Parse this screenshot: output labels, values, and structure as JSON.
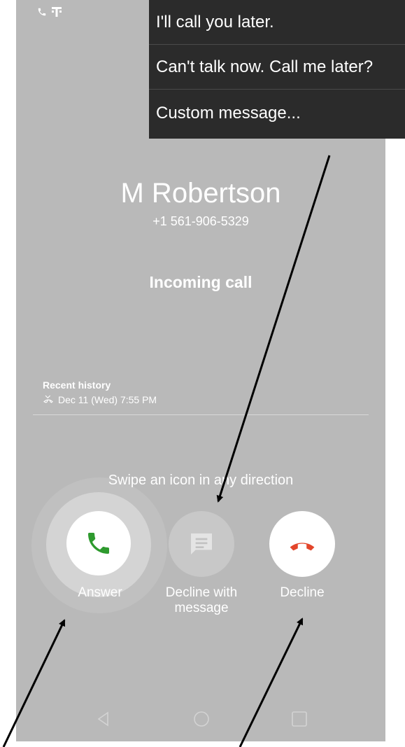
{
  "quick_replies": [
    "I'll call you later.",
    "Can't talk now. Call me later?",
    "Custom message..."
  ],
  "caller": {
    "name": "M Robertson",
    "number": "+1 561-906-5329",
    "status": "Incoming call"
  },
  "recent_history": {
    "title": "Recent history",
    "entry": "Dec 11 (Wed) 7:55 PM"
  },
  "swipe_hint": "Swipe an icon in any direction",
  "actions": {
    "answer_label": "Answer",
    "decline_with_message_label": "Decline with\nmessage",
    "decline_label": "Decline"
  },
  "colors": {
    "answer_green": "#2e9a2e",
    "decline_red": "#e3452a",
    "screen_bg": "#b9b9b9",
    "popup_bg": "#2b2b2b"
  },
  "icons": {
    "status": [
      "phone-icon",
      "t-mobile-icon"
    ],
    "recent_entry": "missed-call-icon",
    "answer": "phone-icon",
    "decline_with_message": "message-icon",
    "decline": "hang-up-icon",
    "nav": [
      "back-icon",
      "home-icon",
      "recents-icon"
    ]
  }
}
